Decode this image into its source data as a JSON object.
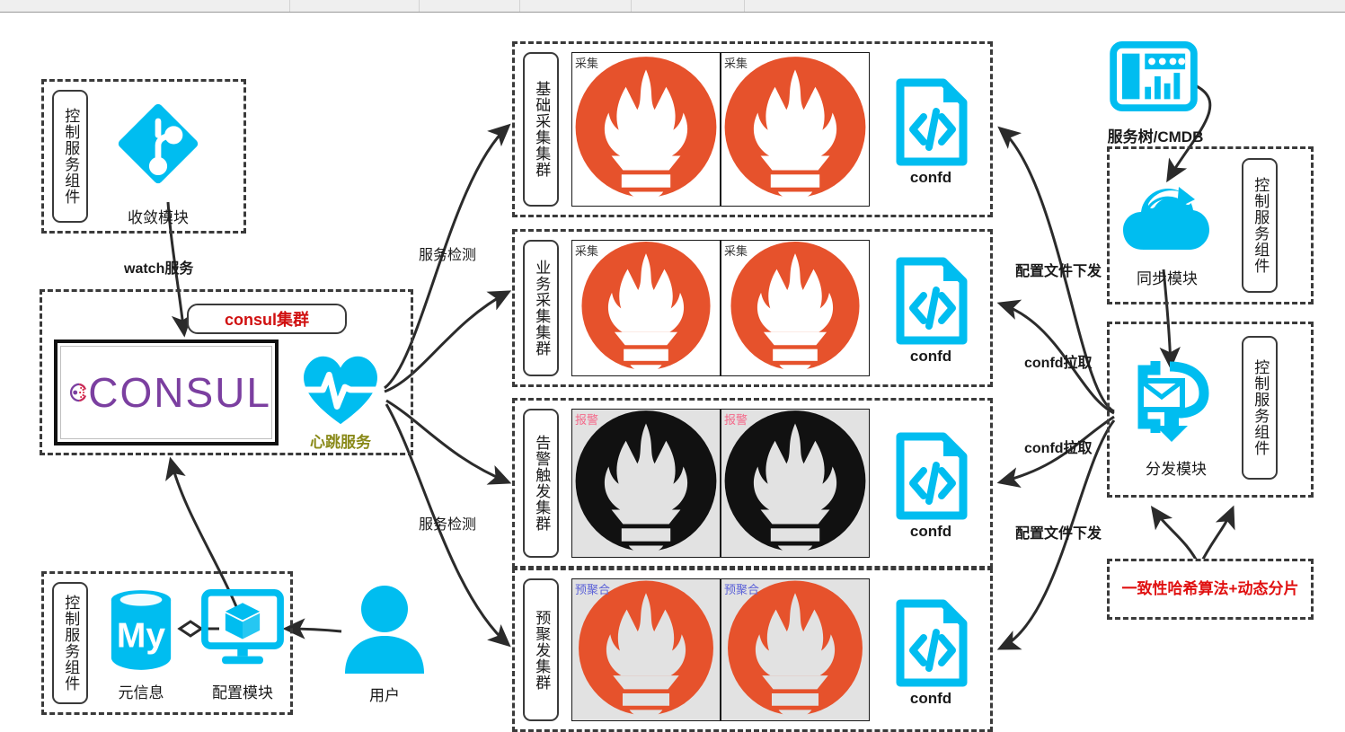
{
  "toolbar": {
    "divider_positions": [
      322,
      466,
      578,
      702,
      828
    ]
  },
  "colors": {
    "cyan": "#00bdf0",
    "prometheus_orange": "#e6522c",
    "prometheus_black": "#111111",
    "consul_purple": "#7b3fa0",
    "consul_magenta": "#c62a5a",
    "red_text": "#d01010",
    "olive_text": "#8a8a1a",
    "pink_tag": "#f4698a",
    "blue_tag": "#5c62d8",
    "gray_cell_bg": "#e2e2e2",
    "dash_stroke": "#3a3a3a"
  },
  "control_component_label": "控制服务组件",
  "left": {
    "converge": {
      "box_label": "控制服务组件",
      "icon": "code-branch-icon",
      "caption": "收敛模块"
    },
    "watch_edge_label": "watch服务",
    "consul": {
      "pill_label": "consul集群",
      "logo_word": "CONSUL",
      "heartbeat_icon": "heartbeat-icon",
      "heartbeat_caption": "心跳服务"
    },
    "meta": {
      "box_label": "控制服务组件",
      "db_icon": "mysql-database-icon",
      "db_caption": "元信息",
      "monitor_icon": "config-monitor-icon",
      "monitor_caption": "配置模块"
    },
    "user": {
      "icon": "user-icon",
      "caption": "用户"
    }
  },
  "service_detect_labels": [
    "服务检测",
    "服务检测"
  ],
  "clusters": [
    {
      "name": "基础采集集群",
      "tag": "采集",
      "tag_color": "#3a3a3a",
      "torch_color": "#e6522c",
      "cell_bg": "#ffffff",
      "flame_color": "#ffffff",
      "confd_label": "confd"
    },
    {
      "name": "业务采集集群",
      "tag": "采集",
      "tag_color": "#3a3a3a",
      "torch_color": "#e6522c",
      "cell_bg": "#ffffff",
      "flame_color": "#ffffff",
      "confd_label": "confd"
    },
    {
      "name": "告警触发集群",
      "tag": "报警",
      "tag_color": "#f4698a",
      "torch_color": "#111111",
      "cell_bg": "#e2e2e2",
      "flame_color": "#e2e2e2",
      "confd_label": "confd"
    },
    {
      "name": "预聚发集群",
      "tag": "预聚合",
      "tag_color": "#5c62d8",
      "torch_color": "#e6522c",
      "cell_bg": "#e2e2e2",
      "flame_color": "#e2e2e2",
      "confd_label": "confd"
    }
  ],
  "right": {
    "cmdb": {
      "icon": "dashboard-icon",
      "caption": "服务树/CMDB"
    },
    "sync": {
      "box_label": "控制服务组件",
      "icon": "cloud-sync-icon",
      "caption": "同步模块"
    },
    "dispatch": {
      "box_label": "控制服务组件",
      "icon": "mail-distribute-icon",
      "caption": "分发模块"
    },
    "hash_note": "一致性哈希算法+动态分片"
  },
  "edge_labels": {
    "config_push_top": "配置文件下发",
    "confd_pull_1": "confd拉取",
    "confd_pull_2": "confd拉取",
    "config_push_bottom": "配置文件下发"
  }
}
